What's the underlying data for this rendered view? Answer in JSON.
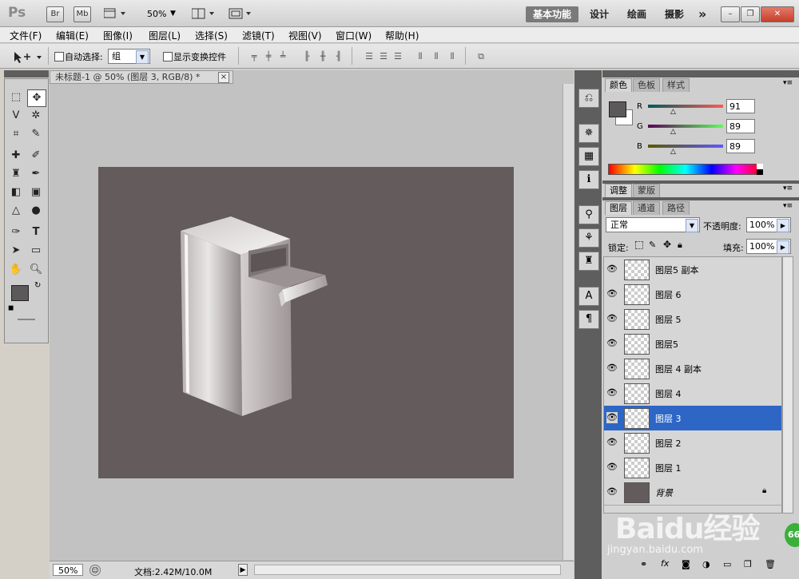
{
  "app": {
    "logo": "Ps",
    "bridge_btn": "Br",
    "minibridge_btn": "Mb",
    "zoom_select": "50%",
    "workspaces": [
      "基本功能",
      "设计",
      "绘画",
      "摄影"
    ],
    "more": "»"
  },
  "menu": [
    "文件(F)",
    "编辑(E)",
    "图像(I)",
    "图层(L)",
    "选择(S)",
    "滤镜(T)",
    "视图(V)",
    "窗口(W)",
    "帮助(H)"
  ],
  "options": {
    "auto_select_label": "自动选择:",
    "auto_select_value": "组",
    "show_transform_label": "显示变换控件"
  },
  "document": {
    "tab_title": "未标题-1 @ 50% (图层 3, RGB/8) *",
    "close": "×",
    "canvas_color": "#645b5c"
  },
  "status": {
    "zoom": "50%",
    "doc_info": "文档:2.42M/10.0M"
  },
  "color_panel": {
    "tabs": [
      "颜色",
      "色板",
      "样式"
    ],
    "channels": [
      {
        "label": "R",
        "value": "91"
      },
      {
        "label": "G",
        "value": "89"
      },
      {
        "label": "B",
        "value": "89"
      }
    ],
    "foreground": "#5b5959"
  },
  "adjust_panel": {
    "tabs": [
      "调整",
      "蒙版"
    ]
  },
  "layers_panel": {
    "tabs": [
      "图层",
      "通道",
      "路径"
    ],
    "blend_mode": "正常",
    "opacity_label": "不透明度:",
    "opacity_value": "100%",
    "lock_label": "锁定:",
    "fill_label": "填充:",
    "fill_value": "100%",
    "layers": [
      {
        "name": "图层5 副本",
        "selected": false
      },
      {
        "name": "图层 6",
        "selected": false
      },
      {
        "name": "图层 5",
        "selected": false
      },
      {
        "name": "图层5",
        "selected": false
      },
      {
        "name": "图层 4 副本",
        "selected": false
      },
      {
        "name": "图层 4",
        "selected": false
      },
      {
        "name": "图层 3",
        "selected": true
      },
      {
        "name": "图层 2",
        "selected": false
      },
      {
        "name": "图层 1",
        "selected": false
      },
      {
        "name": "背景",
        "selected": false
      }
    ]
  },
  "watermark": {
    "text": "Baidu经验",
    "url": "jingyan.baidu.com",
    "badge": "66"
  }
}
